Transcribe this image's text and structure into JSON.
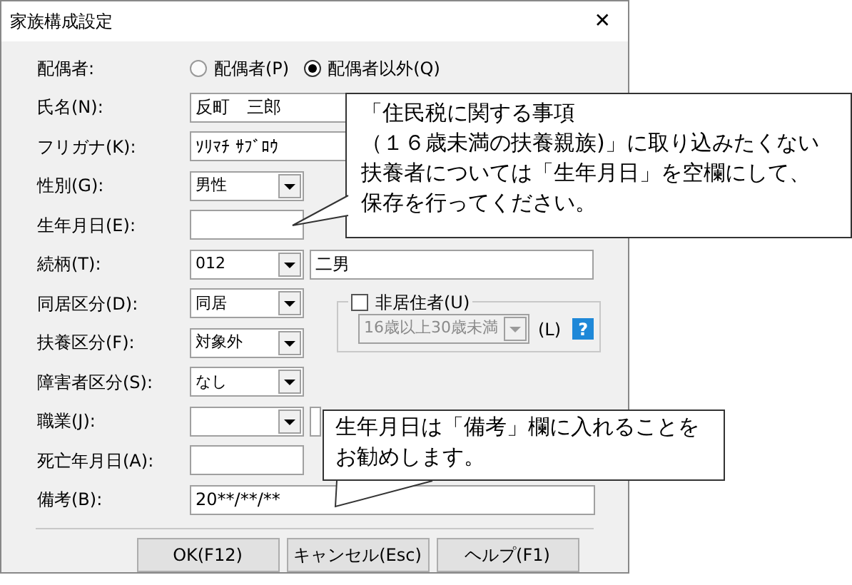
{
  "window": {
    "title": "家族構成設定",
    "close_glyph": "✕"
  },
  "spouse": {
    "label": "配偶者:",
    "options": [
      {
        "label": "配偶者(P)",
        "selected": false
      },
      {
        "label": "配偶者以外(Q)",
        "selected": true
      }
    ]
  },
  "fields": [
    {
      "kind": "text",
      "label": "氏名(N):",
      "value": "反町　三郎"
    },
    {
      "kind": "text",
      "label": "フリガナ(K):",
      "value": "ｿﾘﾏﾁ ｻﾌﾞﾛｳ"
    },
    {
      "kind": "combo",
      "label": "性別(G):",
      "value": "男性"
    },
    {
      "kind": "short",
      "label": "生年月日(E):"
    },
    {
      "kind": "combo_text",
      "label": "続柄(T):",
      "value": "012",
      "extra": "二男"
    },
    {
      "kind": "combo",
      "label": "同居区分(D):",
      "value": "同居"
    },
    {
      "kind": "combo",
      "label": "扶養区分(F):",
      "value": "対象外"
    },
    {
      "kind": "combo",
      "label": "障害者区分(S):",
      "value": "なし"
    },
    {
      "kind": "combo_text",
      "label": "職業(J):"
    },
    {
      "kind": "short",
      "label": "死亡年月日(A):"
    },
    {
      "kind": "text",
      "label": "備考(B):",
      "value": "20**/**/**"
    }
  ],
  "non_resident": {
    "label": "非居住者(U)",
    "checked": false,
    "combo": {
      "value": "16歳以上30歳未満",
      "disabled": true
    },
    "suffix": "(L)",
    "help_glyph": "?"
  },
  "buttons": [
    "OK(F12)",
    "キャンセル(Esc)",
    "ヘルプ(F1)"
  ],
  "callouts": [
    {
      "lines": [
        "「住民税に関する事項",
        "（１６歳未満の扶養親族)」に取り込みたくない",
        "扶養者については「生年月日」を空欄にして、",
        "保存を行ってください。"
      ]
    },
    {
      "lines": [
        "生年月日は「備考」欄に入れることを",
        "お勧めします。"
      ]
    }
  ]
}
